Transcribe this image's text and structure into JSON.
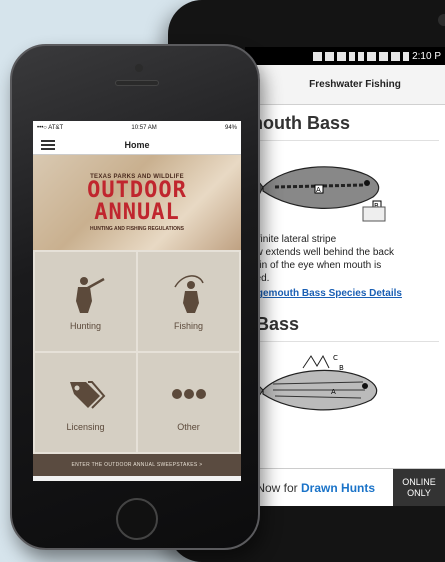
{
  "android": {
    "status_time": "2:10 P",
    "toolbar_title": "Freshwater Fishing",
    "section1_title": "emouth Bass",
    "fish1_labels": [
      "A",
      "B"
    ],
    "fish1_lines": [
      "Definite lateral stripe",
      "Jaw extends well behind the back",
      "argin of the eye when mouth is",
      "osed."
    ],
    "details_link": "rgemouth Bass Species Details",
    "section2_title": "w Bass",
    "fish2_labels": [
      "A",
      "B",
      "C"
    ],
    "banner": {
      "text_prefix": "y Now for ",
      "text_highlight": "Drawn Hunts",
      "online_line1": "ONLINE",
      "online_line2": "ONLY"
    }
  },
  "iphone": {
    "status": {
      "carrier": "•••○ AT&T",
      "time": "10:57 AM",
      "battery": "94%"
    },
    "nav_title": "Home",
    "hero": {
      "sup": "TEXAS PARKS AND WILDLIFE",
      "line1": "OUTDOOR",
      "line2": "ANNUAL",
      "sub": "HUNTING AND FISHING REGULATIONS"
    },
    "tiles": [
      {
        "label": "Hunting",
        "icon": "hunter-icon"
      },
      {
        "label": "Fishing",
        "icon": "fisher-icon"
      },
      {
        "label": "Licensing",
        "icon": "tags-icon"
      },
      {
        "label": "Other",
        "icon": "more-dots-icon"
      }
    ],
    "sweepstakes": "ENTER THE OUTDOOR ANNUAL SWEEPSTAKES >"
  },
  "colors": {
    "hero_red": "#c0262e",
    "tile_bg": "#d5cfc3",
    "tile_icon": "#5c4a3b",
    "sweeps_bar": "#5a4b40",
    "link_blue": "#1a5fb4",
    "background": "#d6e4ec"
  }
}
